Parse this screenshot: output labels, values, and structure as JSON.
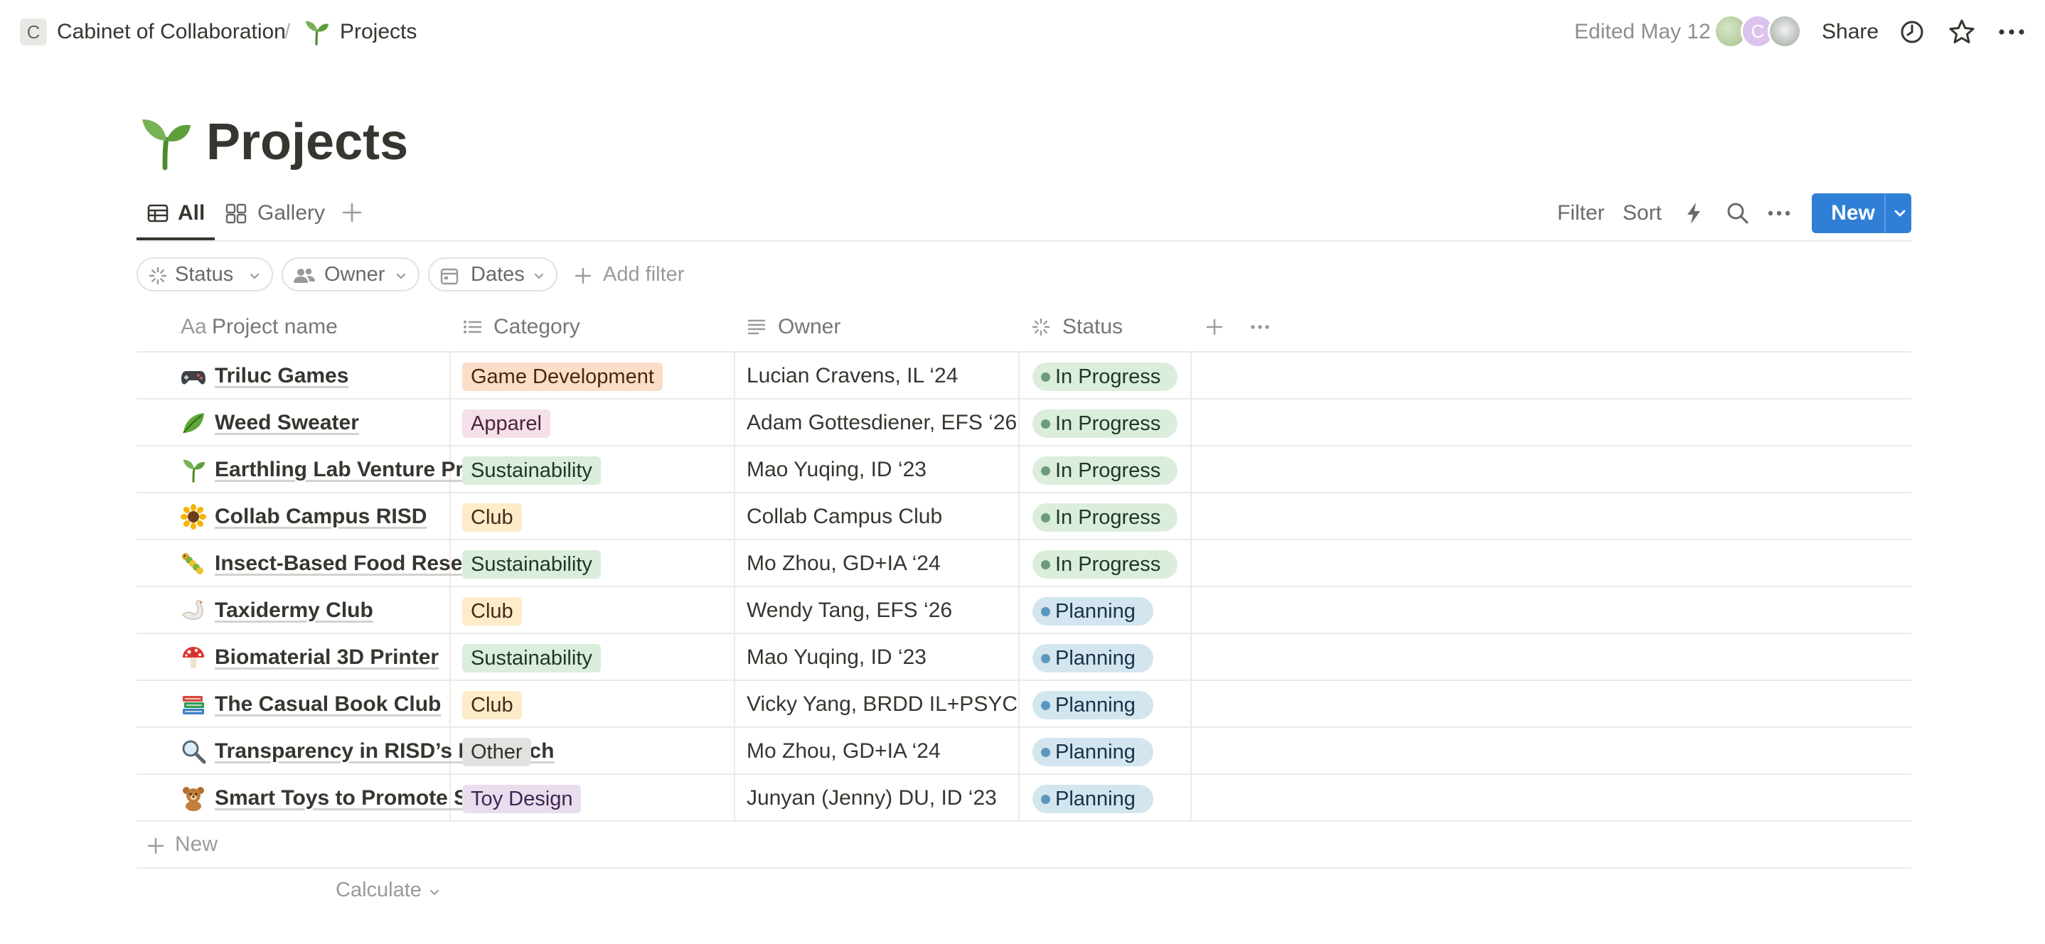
{
  "breadcrumb": {
    "workspace_initial": "C",
    "workspace": "Cabinet of Collaboration",
    "separator": "/",
    "page": "Projects"
  },
  "topbar": {
    "edited": "Edited May 12",
    "avatar_initial": "C",
    "share": "Share",
    "icons": [
      "clock-icon",
      "star-icon",
      "more-icon"
    ]
  },
  "page": {
    "title": "Projects",
    "emoji": "seedling"
  },
  "views": {
    "tabs": [
      {
        "label": "All",
        "icon": "table-icon",
        "active": true
      },
      {
        "label": "Gallery",
        "icon": "gallery-icon",
        "active": false
      }
    ]
  },
  "toolbar": {
    "filter": "Filter",
    "sort": "Sort",
    "new": "New"
  },
  "filters": {
    "pills": [
      {
        "label": "Status",
        "icon": "status-icon"
      },
      {
        "label": "Owner",
        "icon": "people-icon"
      },
      {
        "label": "Dates",
        "icon": "calendar-icon"
      }
    ],
    "add": "Add filter"
  },
  "table": {
    "columns": [
      {
        "label": "Project name",
        "prefix": "Aa"
      },
      {
        "label": "Category",
        "icon": "list-icon"
      },
      {
        "label": "Owner",
        "icon": "text-icon"
      },
      {
        "label": "Status",
        "icon": "status-icon"
      }
    ],
    "rows": [
      {
        "emoji": "game-controller",
        "name": "Triluc Games",
        "category": "Game Development",
        "owner": "Lucian Cravens, IL ‘24",
        "status": "In Progress"
      },
      {
        "emoji": "leaf",
        "name": "Weed Sweater",
        "category": "Apparel",
        "owner": "Adam Gottesdiener, EFS ‘26",
        "status": "In Progress"
      },
      {
        "emoji": "seedling",
        "name": "Earthling Lab Venture Program",
        "category": "Sustainability",
        "owner": "Mao Yuqing, ID ‘23",
        "status": "In Progress"
      },
      {
        "emoji": "sunflower",
        "name": "Collab Campus RISD",
        "category": "Club",
        "owner": "Collab Campus Club",
        "status": "In Progress"
      },
      {
        "emoji": "caterpillar",
        "name": "Insect-Based Food Research",
        "category": "Sustainability",
        "owner": "Mo Zhou, GD+IA ‘24",
        "status": "In Progress"
      },
      {
        "emoji": "swan",
        "name": "Taxidermy Club",
        "category": "Club",
        "owner": "Wendy Tang, EFS ‘26",
        "status": "Planning"
      },
      {
        "emoji": "mushroom",
        "name": "Biomaterial 3D Printer",
        "category": "Sustainability",
        "owner": "Mao Yuqing, ID ‘23",
        "status": "Planning"
      },
      {
        "emoji": "books",
        "name": "The Casual Book Club",
        "category": "Club",
        "owner": "Vicky Yang, BRDD IL+PSYCH ‘",
        "status": "Planning"
      },
      {
        "emoji": "magnifying-glass",
        "name": "Transparency in RISD’s Research",
        "category": "Other",
        "owner": "Mo Zhou, GD+IA ‘24",
        "status": "Planning"
      },
      {
        "emoji": "teddy-bear",
        "name": "Smart Toys to Promote STEM",
        "category": "Toy Design",
        "owner": "Junyan (Jenny) DU, ID ‘23",
        "status": "Planning"
      }
    ],
    "new_row": "New",
    "calculate": "Calculate"
  },
  "colors": {
    "accent": "#2f7fd6",
    "text": "#37352f",
    "muted": "#787774",
    "in_progress_bg": "#dbeddb",
    "planning_bg": "#d3e5ef"
  }
}
